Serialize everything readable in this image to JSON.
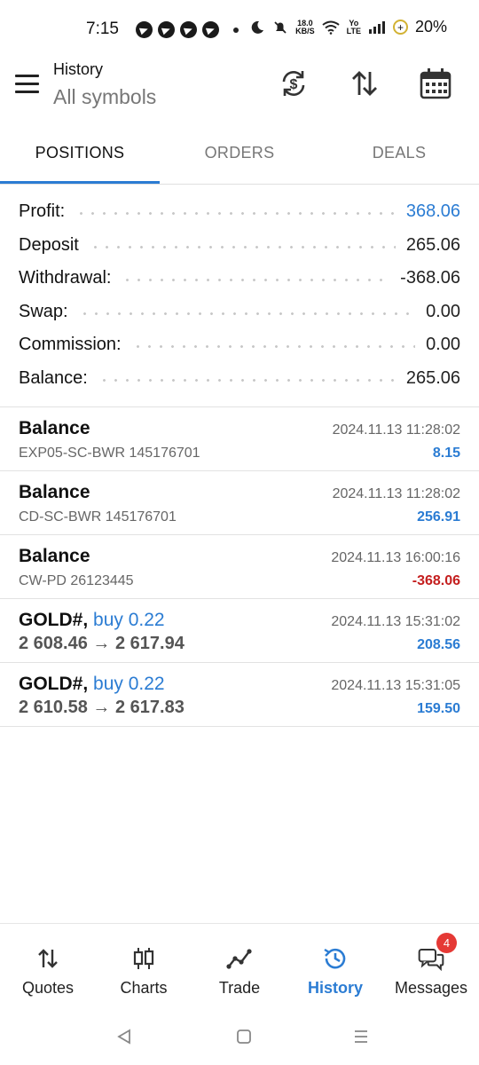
{
  "status_bar": {
    "time": "7:15",
    "net_speed_top": "18.0",
    "net_speed_bottom": "KB/S",
    "lte_top": "Yo",
    "lte_bottom": "LTE",
    "battery": "20%"
  },
  "header": {
    "title": "History",
    "subtitle": "All symbols"
  },
  "tabs": [
    {
      "label": "POSITIONS",
      "active": true
    },
    {
      "label": "ORDERS",
      "active": false
    },
    {
      "label": "DEALS",
      "active": false
    }
  ],
  "summary": [
    {
      "label": "Profit:",
      "value": "368.06",
      "highlight": true
    },
    {
      "label": "Deposit",
      "value": "265.06"
    },
    {
      "label": "Withdrawal:",
      "value": "-368.06"
    },
    {
      "label": "Swap:",
      "value": "0.00"
    },
    {
      "label": "Commission:",
      "value": "0.00"
    },
    {
      "label": "Balance:",
      "value": "265.06"
    }
  ],
  "deals": [
    {
      "title": "Balance",
      "subtitle": "EXP05-SC-BWR 145176701",
      "time": "2024.11.13 11:28:02",
      "amount": "8.15"
    },
    {
      "title": "Balance",
      "subtitle": "CD-SC-BWR 145176701",
      "time": "2024.11.13 11:28:02",
      "amount": "256.91"
    },
    {
      "title": "Balance",
      "subtitle": "CW-PD 26123445",
      "time": "2024.11.13 16:00:16",
      "amount": "-368.06"
    },
    {
      "symbol": "GOLD#,",
      "side": "buy 0.22",
      "prices": "2 608.46 → 2 617.94",
      "time": "2024.11.13 15:31:02",
      "amount": "208.56"
    },
    {
      "symbol": "GOLD#,",
      "side": "buy 0.22",
      "prices": "2 610.58 → 2 617.83",
      "time": "2024.11.13 15:31:05",
      "amount": "159.50"
    }
  ],
  "bottom_nav": [
    {
      "label": "Quotes",
      "icon": "arrows-updown-icon"
    },
    {
      "label": "Charts",
      "icon": "candlestick-icon"
    },
    {
      "label": "Trade",
      "icon": "trade-line-icon"
    },
    {
      "label": "History",
      "icon": "history-clock-icon",
      "active": true
    },
    {
      "label": "Messages",
      "icon": "chat-bubbles-icon",
      "badge": "4"
    }
  ],
  "colors": {
    "accent": "#2b7cd3",
    "negative": "#c41e1e",
    "badge": "#e53935"
  }
}
